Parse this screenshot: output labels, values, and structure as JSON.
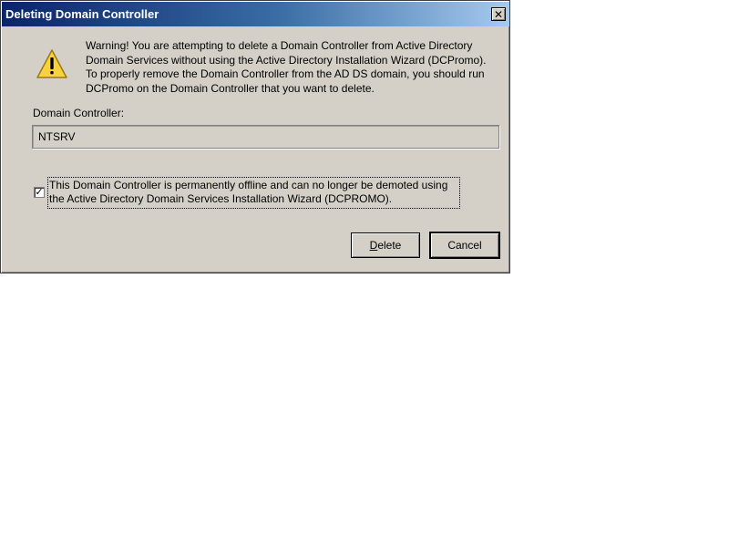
{
  "dialog": {
    "title": "Deleting Domain Controller",
    "close_glyph": "✕",
    "warning_icon": "warning-triangle-icon",
    "warning_text": "Warning! You are attempting to delete a Domain Controller from Active Directory Domain Services without using the Active Directory Installation Wizard (DCPromo). To properly remove the Domain Controller from the AD DS domain, you should run DCPromo on the Domain Controller that you want to delete.",
    "dc_label": "Domain Controller:",
    "dc_value": "NTSRV",
    "offline_checkbox": {
      "checked": true,
      "check_glyph": "✓",
      "label": "This Domain Controller is permanently offline and can no longer be demoted using the Active Directory Domain Services Installation Wizard (DCPROMO)."
    },
    "buttons": {
      "delete_mnemonic": "D",
      "delete_rest": "elete",
      "cancel_label": "Cancel"
    }
  },
  "colors": {
    "dialog_bg": "#d4d0c8",
    "title_gradient_start": "#0a246a",
    "title_gradient_end": "#a6caf0",
    "warning_yellow": "#f7d23e"
  }
}
